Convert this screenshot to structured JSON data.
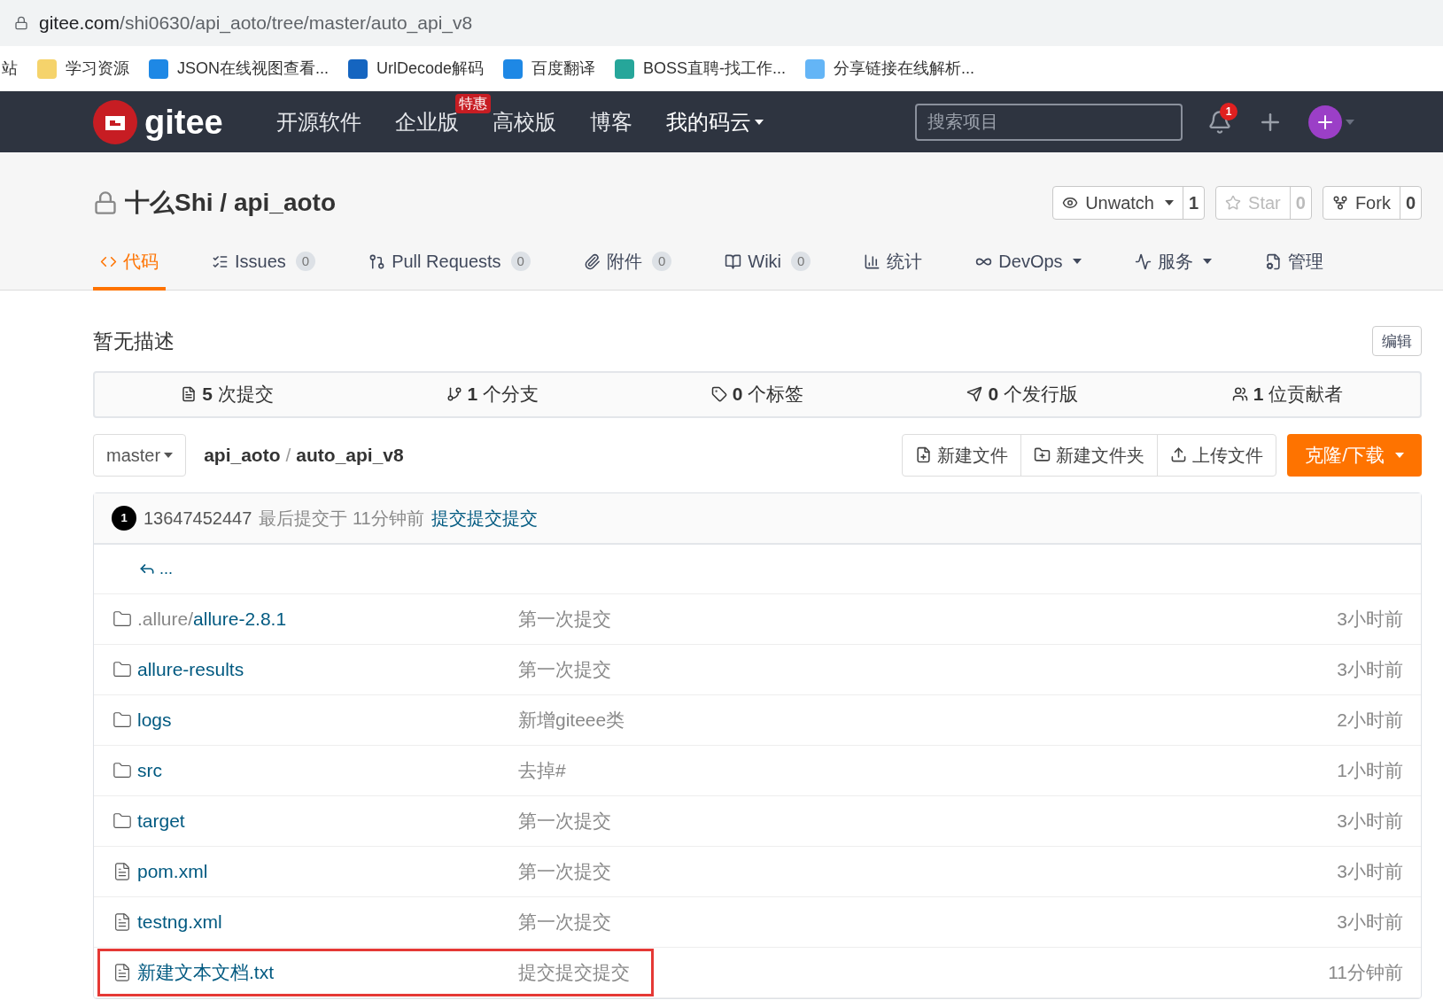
{
  "address_bar": {
    "host": "gitee.com",
    "path": "/shi0630/api_aoto/tree/master/auto_api_v8"
  },
  "bookmarks": [
    "站",
    "学习资源",
    "JSON在线视图查看...",
    "UrlDecode解码",
    "百度翻译",
    "BOSS直聘-找工作...",
    "分享链接在线解析..."
  ],
  "nav": {
    "logo": "gitee",
    "items": [
      {
        "label": "开源软件",
        "caret": false
      },
      {
        "label": "企业版",
        "badge": "特惠",
        "caret": false
      },
      {
        "label": "高校版",
        "caret": false
      },
      {
        "label": "博客",
        "caret": false
      },
      {
        "label": "我的码云",
        "caret": true
      }
    ],
    "search": {
      "placeholder": "搜索项目"
    },
    "notification_count": "1"
  },
  "repo": {
    "title": "十么Shi / api_aoto",
    "private": true,
    "actions": [
      {
        "label": "Unwatch",
        "count": "1",
        "caret": true,
        "disabled": false
      },
      {
        "label": "Star",
        "count": "0",
        "caret": false,
        "disabled": true
      },
      {
        "label": "Fork",
        "count": "0",
        "caret": false,
        "disabled": false
      }
    ]
  },
  "tabs": [
    {
      "label": "代码",
      "caret": false,
      "selected": true
    },
    {
      "label": "Issues",
      "count": "0",
      "caret": false,
      "selected": false
    },
    {
      "label": "Pull Requests",
      "count": "0",
      "caret": false,
      "selected": false
    },
    {
      "label": "附件",
      "count": "0",
      "caret": false,
      "selected": false
    },
    {
      "label": "Wiki",
      "count": "0",
      "caret": false,
      "selected": false
    },
    {
      "label": "统计",
      "caret": false,
      "selected": false
    },
    {
      "label": "DevOps",
      "caret": true,
      "selected": false
    },
    {
      "label": "服务",
      "caret": true,
      "selected": false
    },
    {
      "label": "管理",
      "caret": false,
      "selected": false
    }
  ],
  "description": "暂无描述",
  "edit_button": "编辑",
  "stats": [
    {
      "count": "5",
      "label": "次提交"
    },
    {
      "count": "1",
      "label": "个分支"
    },
    {
      "count": "0",
      "label": "个标签"
    },
    {
      "count": "0",
      "label": "个发行版"
    },
    {
      "count": "1",
      "label": "位贡献者"
    }
  ],
  "branch": "master",
  "breadcrumb": [
    "api_aoto",
    "auto_api_v8"
  ],
  "breadcrumb_separator": "/",
  "file_actions": [
    "新建文件",
    "新建文件夹",
    "上传文件"
  ],
  "clone_button": "克隆/下载",
  "commit": {
    "avatar": "1",
    "author": "13647452447",
    "meta": "最后提交于 11分钟前",
    "message": "提交提交提交"
  },
  "back_row": "...",
  "files": [
    {
      "kind": "folder",
      "prefix": ".allure/",
      "name": "allure-2.8.1",
      "message": "第一次提交",
      "time": "3小时前",
      "highlighted": false
    },
    {
      "kind": "folder",
      "name": "allure-results",
      "message": "第一次提交",
      "time": "3小时前",
      "highlighted": false
    },
    {
      "kind": "folder",
      "name": "logs",
      "message": "新增giteee类",
      "time": "2小时前",
      "highlighted": false
    },
    {
      "kind": "folder",
      "name": "src",
      "message": "去掉#",
      "time": "1小时前",
      "highlighted": false
    },
    {
      "kind": "folder",
      "name": "target",
      "message": "第一次提交",
      "time": "3小时前",
      "highlighted": false
    },
    {
      "kind": "file",
      "name": "pom.xml",
      "message": "第一次提交",
      "time": "3小时前",
      "highlighted": false
    },
    {
      "kind": "file",
      "name": "testng.xml",
      "message": "第一次提交",
      "time": "3小时前",
      "highlighted": false
    },
    {
      "kind": "file",
      "name": "新建文本文档.txt",
      "message": "提交提交提交",
      "time": "11分钟前",
      "highlighted": true
    }
  ]
}
